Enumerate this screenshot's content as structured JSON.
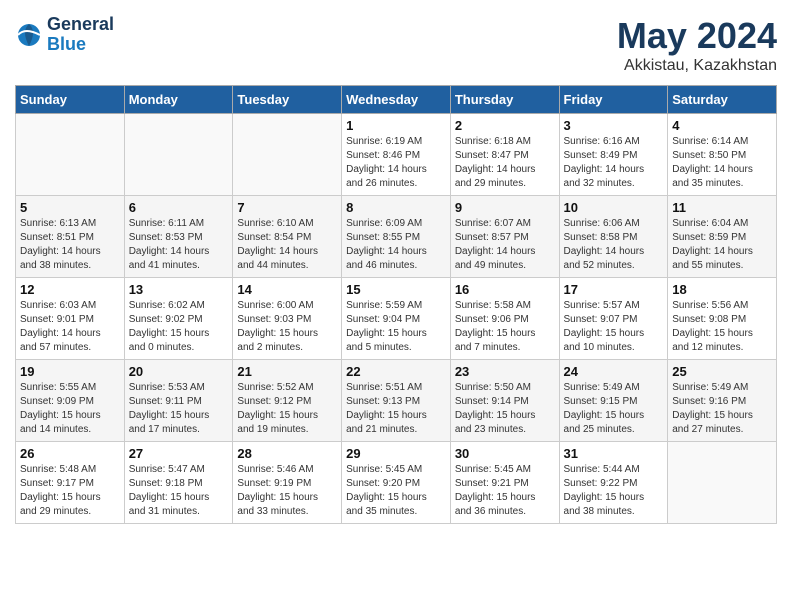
{
  "header": {
    "logo_line1": "General",
    "logo_line2": "Blue",
    "month": "May 2024",
    "location": "Akkistau, Kazakhstan"
  },
  "weekdays": [
    "Sunday",
    "Monday",
    "Tuesday",
    "Wednesday",
    "Thursday",
    "Friday",
    "Saturday"
  ],
  "weeks": [
    [
      {
        "day": "",
        "info": ""
      },
      {
        "day": "",
        "info": ""
      },
      {
        "day": "",
        "info": ""
      },
      {
        "day": "1",
        "info": "Sunrise: 6:19 AM\nSunset: 8:46 PM\nDaylight: 14 hours\nand 26 minutes."
      },
      {
        "day": "2",
        "info": "Sunrise: 6:18 AM\nSunset: 8:47 PM\nDaylight: 14 hours\nand 29 minutes."
      },
      {
        "day": "3",
        "info": "Sunrise: 6:16 AM\nSunset: 8:49 PM\nDaylight: 14 hours\nand 32 minutes."
      },
      {
        "day": "4",
        "info": "Sunrise: 6:14 AM\nSunset: 8:50 PM\nDaylight: 14 hours\nand 35 minutes."
      }
    ],
    [
      {
        "day": "5",
        "info": "Sunrise: 6:13 AM\nSunset: 8:51 PM\nDaylight: 14 hours\nand 38 minutes."
      },
      {
        "day": "6",
        "info": "Sunrise: 6:11 AM\nSunset: 8:53 PM\nDaylight: 14 hours\nand 41 minutes."
      },
      {
        "day": "7",
        "info": "Sunrise: 6:10 AM\nSunset: 8:54 PM\nDaylight: 14 hours\nand 44 minutes."
      },
      {
        "day": "8",
        "info": "Sunrise: 6:09 AM\nSunset: 8:55 PM\nDaylight: 14 hours\nand 46 minutes."
      },
      {
        "day": "9",
        "info": "Sunrise: 6:07 AM\nSunset: 8:57 PM\nDaylight: 14 hours\nand 49 minutes."
      },
      {
        "day": "10",
        "info": "Sunrise: 6:06 AM\nSunset: 8:58 PM\nDaylight: 14 hours\nand 52 minutes."
      },
      {
        "day": "11",
        "info": "Sunrise: 6:04 AM\nSunset: 8:59 PM\nDaylight: 14 hours\nand 55 minutes."
      }
    ],
    [
      {
        "day": "12",
        "info": "Sunrise: 6:03 AM\nSunset: 9:01 PM\nDaylight: 14 hours\nand 57 minutes."
      },
      {
        "day": "13",
        "info": "Sunrise: 6:02 AM\nSunset: 9:02 PM\nDaylight: 15 hours\nand 0 minutes."
      },
      {
        "day": "14",
        "info": "Sunrise: 6:00 AM\nSunset: 9:03 PM\nDaylight: 15 hours\nand 2 minutes."
      },
      {
        "day": "15",
        "info": "Sunrise: 5:59 AM\nSunset: 9:04 PM\nDaylight: 15 hours\nand 5 minutes."
      },
      {
        "day": "16",
        "info": "Sunrise: 5:58 AM\nSunset: 9:06 PM\nDaylight: 15 hours\nand 7 minutes."
      },
      {
        "day": "17",
        "info": "Sunrise: 5:57 AM\nSunset: 9:07 PM\nDaylight: 15 hours\nand 10 minutes."
      },
      {
        "day": "18",
        "info": "Sunrise: 5:56 AM\nSunset: 9:08 PM\nDaylight: 15 hours\nand 12 minutes."
      }
    ],
    [
      {
        "day": "19",
        "info": "Sunrise: 5:55 AM\nSunset: 9:09 PM\nDaylight: 15 hours\nand 14 minutes."
      },
      {
        "day": "20",
        "info": "Sunrise: 5:53 AM\nSunset: 9:11 PM\nDaylight: 15 hours\nand 17 minutes."
      },
      {
        "day": "21",
        "info": "Sunrise: 5:52 AM\nSunset: 9:12 PM\nDaylight: 15 hours\nand 19 minutes."
      },
      {
        "day": "22",
        "info": "Sunrise: 5:51 AM\nSunset: 9:13 PM\nDaylight: 15 hours\nand 21 minutes."
      },
      {
        "day": "23",
        "info": "Sunrise: 5:50 AM\nSunset: 9:14 PM\nDaylight: 15 hours\nand 23 minutes."
      },
      {
        "day": "24",
        "info": "Sunrise: 5:49 AM\nSunset: 9:15 PM\nDaylight: 15 hours\nand 25 minutes."
      },
      {
        "day": "25",
        "info": "Sunrise: 5:49 AM\nSunset: 9:16 PM\nDaylight: 15 hours\nand 27 minutes."
      }
    ],
    [
      {
        "day": "26",
        "info": "Sunrise: 5:48 AM\nSunset: 9:17 PM\nDaylight: 15 hours\nand 29 minutes."
      },
      {
        "day": "27",
        "info": "Sunrise: 5:47 AM\nSunset: 9:18 PM\nDaylight: 15 hours\nand 31 minutes."
      },
      {
        "day": "28",
        "info": "Sunrise: 5:46 AM\nSunset: 9:19 PM\nDaylight: 15 hours\nand 33 minutes."
      },
      {
        "day": "29",
        "info": "Sunrise: 5:45 AM\nSunset: 9:20 PM\nDaylight: 15 hours\nand 35 minutes."
      },
      {
        "day": "30",
        "info": "Sunrise: 5:45 AM\nSunset: 9:21 PM\nDaylight: 15 hours\nand 36 minutes."
      },
      {
        "day": "31",
        "info": "Sunrise: 5:44 AM\nSunset: 9:22 PM\nDaylight: 15 hours\nand 38 minutes."
      },
      {
        "day": "",
        "info": ""
      }
    ]
  ]
}
